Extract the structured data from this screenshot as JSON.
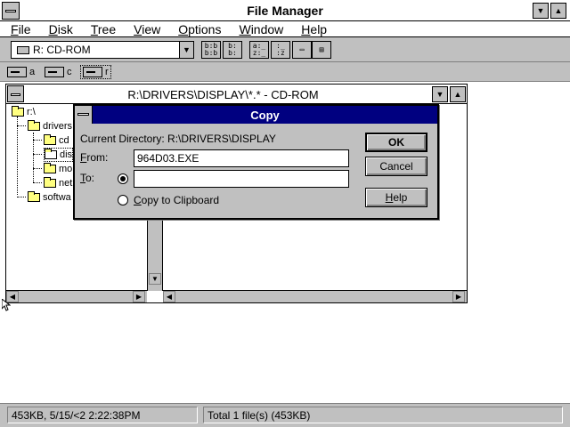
{
  "app": {
    "title": "File Manager"
  },
  "menu": [
    {
      "label": "File",
      "mnemonic": "F",
      "rest": "ile"
    },
    {
      "label": "Disk",
      "mnemonic": "D",
      "rest": "isk"
    },
    {
      "label": "Tree",
      "mnemonic": "T",
      "rest": "ree"
    },
    {
      "label": "View",
      "mnemonic": "V",
      "rest": "iew"
    },
    {
      "label": "Options",
      "mnemonic": "O",
      "rest": "ptions"
    },
    {
      "label": "Window",
      "mnemonic": "W",
      "rest": "indow"
    },
    {
      "label": "Help",
      "mnemonic": "H",
      "rest": "elp"
    }
  ],
  "toolbar": {
    "drive_combo": "R: CD-ROM",
    "buttons": [
      {
        "name": "tree-view",
        "glyph": "b:b b:b"
      },
      {
        "name": "list-view",
        "glyph": "b: b:"
      },
      {
        "name": "sort-name",
        "glyph": "a:_ z:_"
      },
      {
        "name": "sort-type",
        "glyph": ":_ :z"
      },
      {
        "name": "new-window",
        "glyph": "▭▭"
      },
      {
        "name": "properties",
        "glyph": "▤"
      }
    ]
  },
  "drives": [
    {
      "letter": "a"
    },
    {
      "letter": "c"
    },
    {
      "letter": "r"
    }
  ],
  "child_window": {
    "title": "R:\\DRIVERS\\DISPLAY\\*.* - CD-ROM",
    "tree": [
      {
        "label": "r:\\"
      },
      {
        "label": "drivers"
      },
      {
        "label": "cd"
      },
      {
        "label": "dis"
      },
      {
        "label": "mo"
      },
      {
        "label": "net"
      },
      {
        "label": "softwa"
      }
    ]
  },
  "copy_dialog": {
    "title": "Copy",
    "current_dir_label": "Current Directory:",
    "current_dir": "R:\\DRIVERS\\DISPLAY",
    "from_label": "From:",
    "from_value": "964D03.EXE",
    "to_label": "To:",
    "to_value": "",
    "clipboard_label": "Copy to Clipboard",
    "ok": "OK",
    "cancel": "Cancel",
    "help": "Help"
  },
  "status": {
    "left": "453KB, 5/15/<2 2:22:38PM",
    "right": "Total 1 file(s) (453KB)"
  }
}
